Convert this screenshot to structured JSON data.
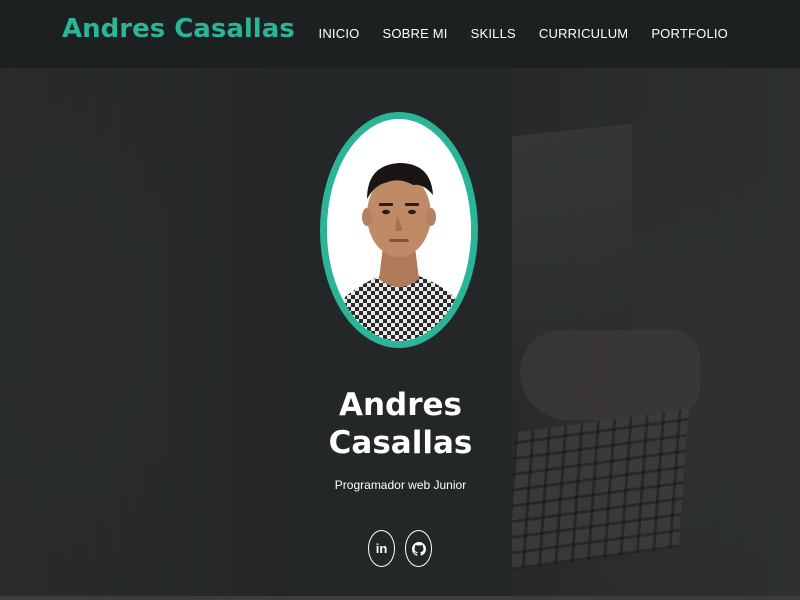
{
  "header": {
    "brand": "Andres Casallas",
    "nav": [
      {
        "label": "INICIO"
      },
      {
        "label": "SOBRE MI"
      },
      {
        "label": "SKILLS"
      },
      {
        "label": "CURRICULUM"
      },
      {
        "label": "PORTFOLIO"
      }
    ]
  },
  "profile": {
    "name_line1": "Andres",
    "name_line2": "Casallas",
    "role": "Programador web Junior",
    "socials": [
      {
        "name": "linkedin-icon",
        "glyph": "in"
      },
      {
        "name": "github-icon",
        "glyph": ""
      }
    ]
  },
  "colors": {
    "accent": "#2bb596",
    "header_bg": "#1d2021",
    "card_bg": "#232728"
  }
}
